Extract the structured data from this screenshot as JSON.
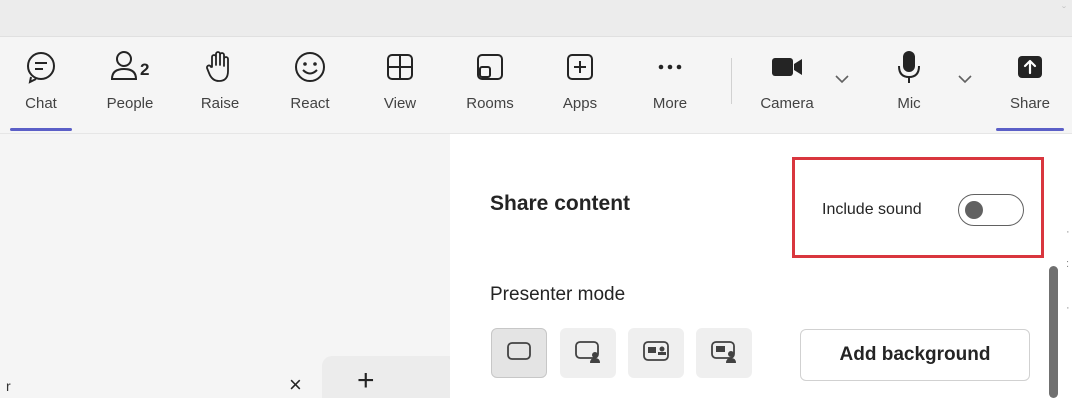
{
  "toolbar": {
    "items": [
      {
        "label": "Chat",
        "icon": "chat-icon"
      },
      {
        "label": "People",
        "icon": "people-icon",
        "count": "2"
      },
      {
        "label": "Raise",
        "icon": "raise-hand-icon"
      },
      {
        "label": "React",
        "icon": "react-icon"
      },
      {
        "label": "View",
        "icon": "view-icon"
      },
      {
        "label": "Rooms",
        "icon": "rooms-icon"
      },
      {
        "label": "Apps",
        "icon": "apps-icon"
      },
      {
        "label": "More",
        "icon": "more-icon"
      },
      {
        "label": "Camera",
        "icon": "camera-icon"
      },
      {
        "label": "Mic",
        "icon": "mic-icon"
      },
      {
        "label": "Share",
        "icon": "share-icon"
      }
    ]
  },
  "share_panel": {
    "title": "Share content",
    "include_sound_label": "Include sound",
    "include_sound_on": false,
    "presenter_mode_label": "Presenter mode",
    "add_background_label": "Add background"
  },
  "tabs": {
    "close_glyph": "×",
    "add_glyph": "+"
  },
  "colors": {
    "accent": "#5b5fc7",
    "highlight_box": "#d9363e"
  }
}
